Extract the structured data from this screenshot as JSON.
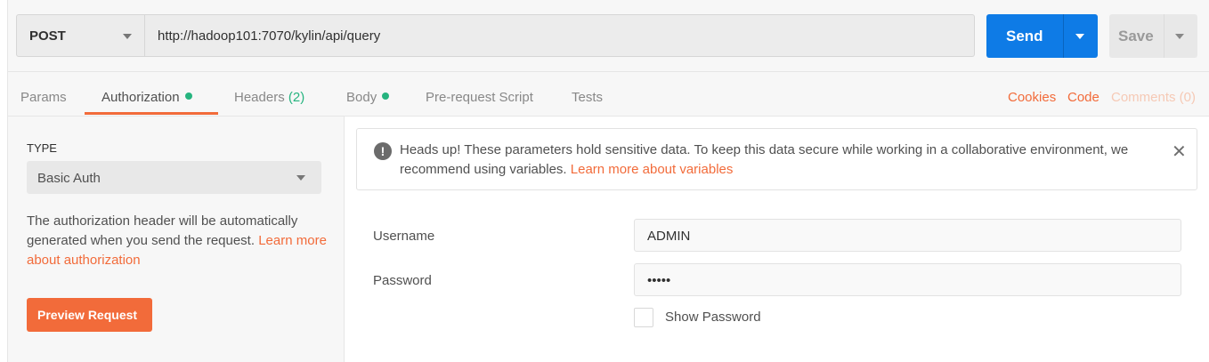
{
  "request": {
    "method": "POST",
    "url": "http://hadoop101:7070/kylin/api/query",
    "send_label": "Send",
    "save_label": "Save"
  },
  "tabs": [
    {
      "label": "Params"
    },
    {
      "label": "Authorization",
      "active": true,
      "indicator": "green-dot"
    },
    {
      "label": "Headers",
      "count": "(2)"
    },
    {
      "label": "Body",
      "indicator": "green-dot"
    },
    {
      "label": "Pre-request Script"
    },
    {
      "label": "Tests"
    }
  ],
  "right_links": {
    "cookies": "Cookies",
    "code": "Code",
    "comments": "Comments (0)"
  },
  "auth_panel": {
    "type_label": "TYPE",
    "type_value": "Basic Auth",
    "description": "The authorization header will be automatically generated when you send the request.",
    "learn_more_link": "Learn more about authorization",
    "preview_button": "Preview Request"
  },
  "notice": {
    "icon": "exclamation-circle-icon",
    "text": "Heads up! These parameters hold sensitive data. To keep this data secure while working in a collaborative environment, we recommend using variables.",
    "link": "Learn more about variables",
    "close_icon": "close-icon"
  },
  "credentials": {
    "username_label": "Username",
    "username_value": "ADMIN",
    "password_label": "Password",
    "password_value": "•••••",
    "show_password_label": "Show Password"
  },
  "colors": {
    "accent_orange": "#f26b3a",
    "send_blue": "#0e7be6",
    "indicator_green": "#26b47f"
  }
}
